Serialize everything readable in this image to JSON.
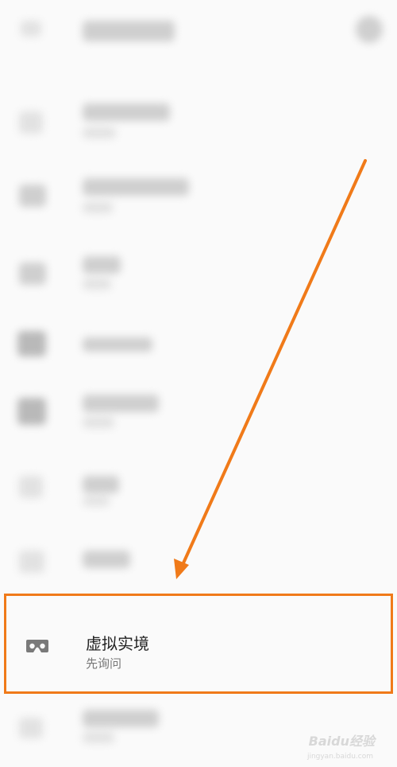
{
  "settings_row": {
    "icon": "vr-headset-icon",
    "title": "虚拟实境",
    "subtitle": "先询问"
  },
  "annotation": {
    "arrow_color": "#f07a19",
    "highlight_color": "#f07a19"
  },
  "watermark": {
    "text": "Baidu经验",
    "url": "jingyan.baidu.com"
  }
}
